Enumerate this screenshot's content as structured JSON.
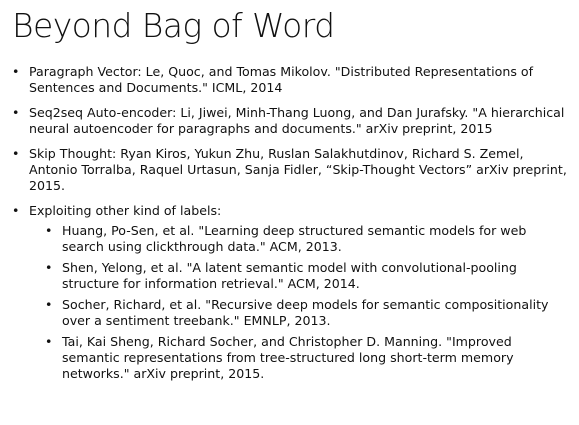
{
  "slide": {
    "title": "Beyond Bag of Word",
    "bullet_glyph": "•",
    "items": [
      {
        "text": "Paragraph Vector: Le, Quoc, and Tomas Mikolov. \"Distributed Representations of Sentences and Documents.\" ICML, 2014"
      },
      {
        "text": "Seq2seq Auto-encoder: Li, Jiwei, Minh-Thang Luong, and Dan Jurafsky. \"A hierarchical neural autoencoder for paragraphs and documents.\" arXiv preprint, 2015"
      },
      {
        "text": "Skip Thought: Ryan Kiros, Yukun Zhu, Ruslan Salakhutdinov, Richard S. Zemel, Antonio Torralba, Raquel Urtasun, Sanja Fidler, “Skip-Thought Vectors” arXiv preprint, 2015."
      },
      {
        "text": "Exploiting other kind of labels:"
      }
    ],
    "subitems": [
      {
        "text": "Huang, Po-Sen, et al. \"Learning deep structured semantic models for web search using clickthrough data.\" ACM, 2013."
      },
      {
        "text": "Shen, Yelong, et al. \"A latent semantic model with convolutional-pooling structure for information retrieval.\" ACM, 2014."
      },
      {
        "text": "Socher, Richard, et al. \"Recursive deep models for semantic compositionality over a sentiment treebank.\" EMNLP, 2013."
      },
      {
        "text": "Tai, Kai Sheng, Richard Socher, and Christopher D. Manning. \"Improved semantic representations from tree-structured long short-term memory networks.\" arXiv preprint, 2015."
      }
    ]
  }
}
